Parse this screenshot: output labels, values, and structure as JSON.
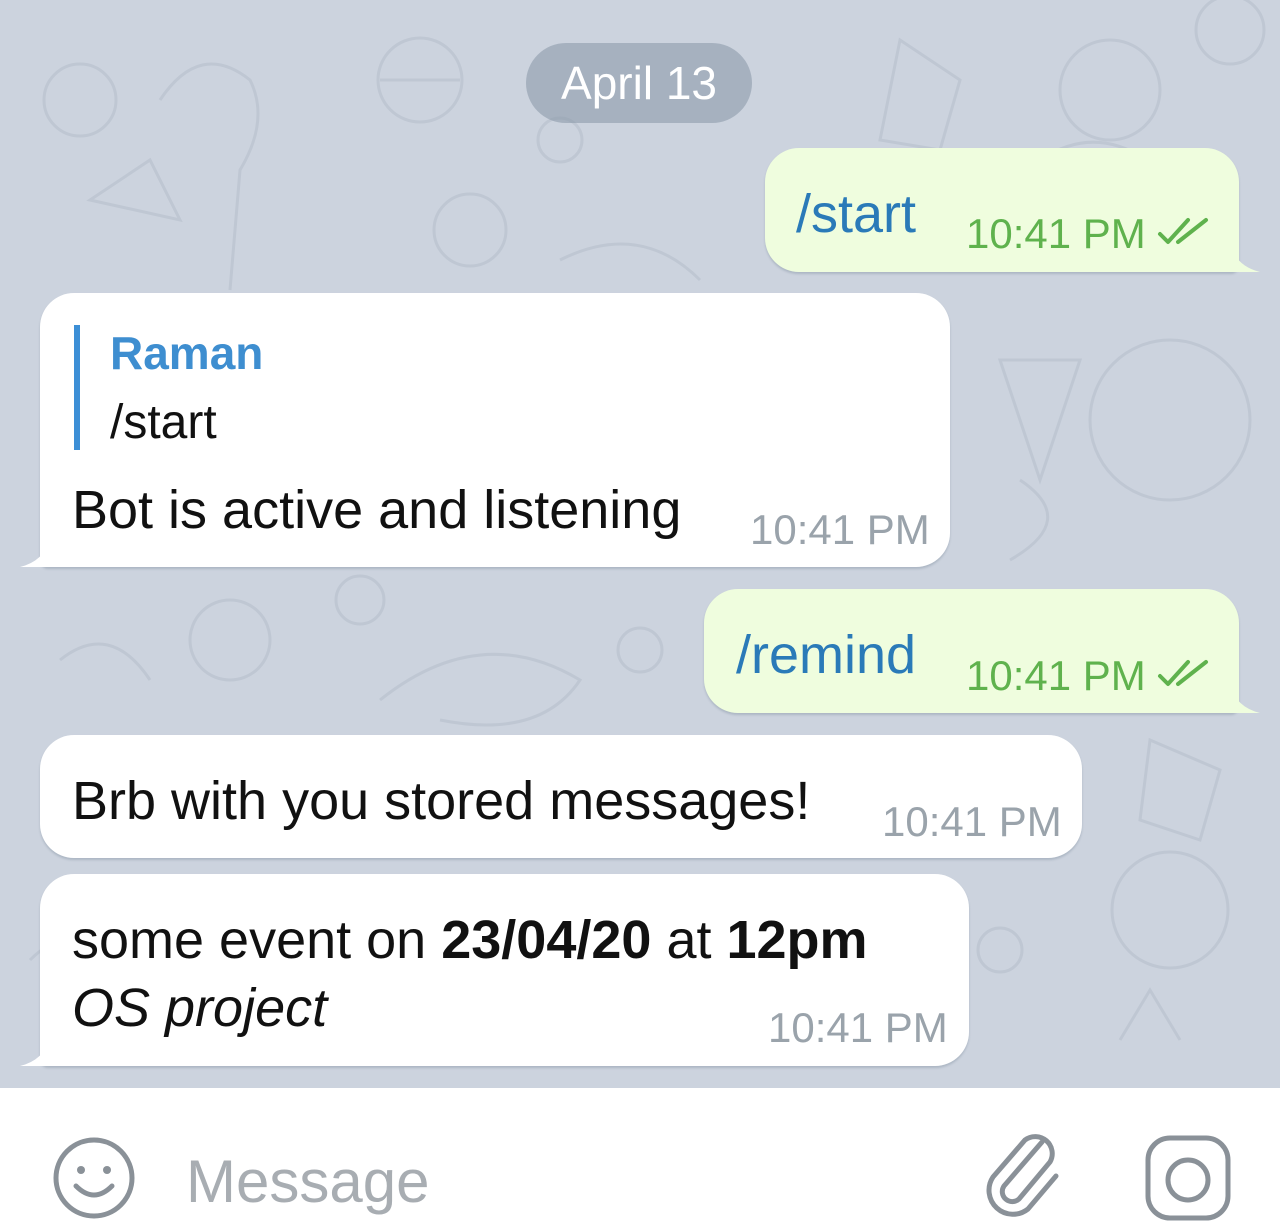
{
  "chat": {
    "date_label": "April 13",
    "messages": [
      {
        "direction": "outgoing",
        "text": "/start",
        "time": "10:41 PM",
        "status": "read"
      },
      {
        "direction": "incoming",
        "reply_to": {
          "sender": "Raman",
          "text": "/start"
        },
        "text": "Bot is active and listening",
        "time": "10:41 PM"
      },
      {
        "direction": "outgoing",
        "text": "/remind",
        "time": "10:41 PM",
        "status": "read"
      },
      {
        "direction": "incoming",
        "text": "Brb with you stored messages!",
        "time": "10:41 PM"
      },
      {
        "direction": "incoming",
        "line1": {
          "prefix": "some event on ",
          "date": "23/04/20",
          "middle": " at ",
          "time_value": "12pm"
        },
        "line2": "OS project",
        "time": "10:41 PM"
      }
    ]
  },
  "input": {
    "placeholder": "Message",
    "emoji_icon": "emoji-icon",
    "attach_icon": "paperclip-icon",
    "camera_icon": "camera-icon"
  },
  "colors": {
    "chat_background": "#ccd3de",
    "outgoing_bubble": "#effdde",
    "incoming_bubble": "#ffffff",
    "command_link": "#2a7ab8",
    "outgoing_time": "#5fb24d",
    "incoming_time": "#9aa3ab",
    "quote_accent": "#3c8fd6"
  }
}
